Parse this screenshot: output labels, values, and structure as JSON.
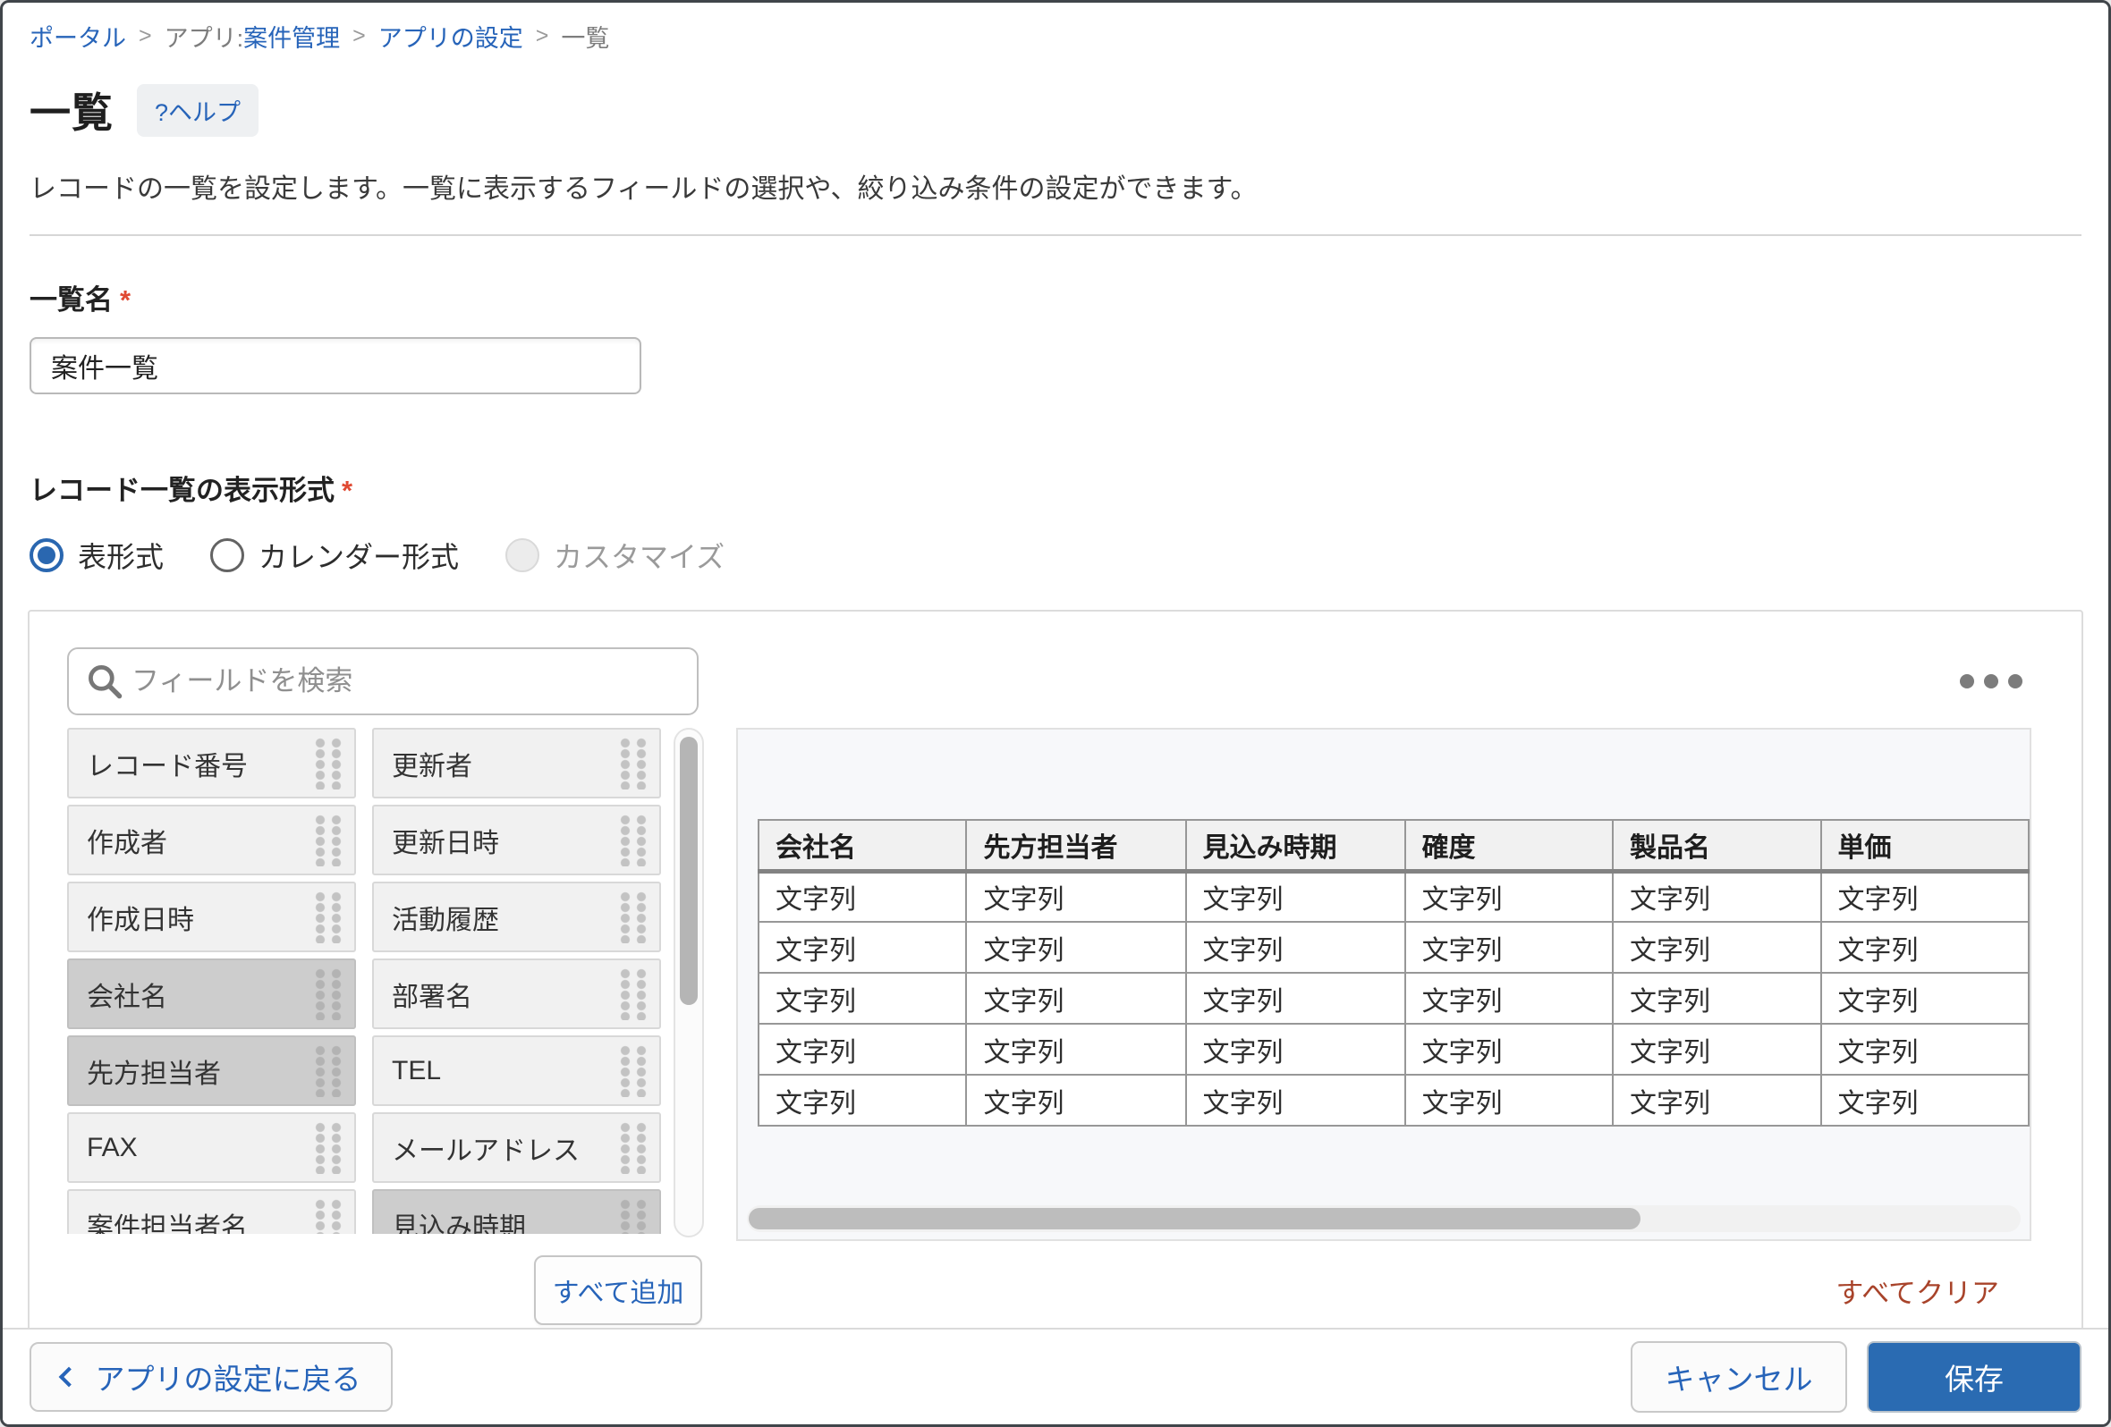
{
  "breadcrumb": {
    "separator": ">",
    "items": [
      {
        "label": "ポータル",
        "type": "link"
      },
      {
        "label": "アプリ:",
        "type": "text",
        "joined_with_next": true
      },
      {
        "label": "案件管理",
        "type": "link"
      },
      {
        "label": "アプリの設定",
        "type": "link"
      },
      {
        "label": "一覧",
        "type": "current"
      }
    ]
  },
  "page": {
    "title": "一覧",
    "help_label": "?ヘルプ",
    "description": "レコードの一覧を設定します。一覧に表示するフィールドの選択や、絞り込み条件の設定ができます。"
  },
  "form": {
    "required_mark": "*",
    "list_name": {
      "label": "一覧名",
      "value": "案件一覧"
    },
    "display_format": {
      "label": "レコード一覧の表示形式",
      "options": [
        {
          "label": "表形式",
          "state": "selected"
        },
        {
          "label": "カレンダー形式",
          "state": "unselected"
        },
        {
          "label": "カスタマイズ",
          "state": "disabled"
        }
      ]
    }
  },
  "field_picker": {
    "search_placeholder": "フィールドを検索",
    "more_menu_icon": "ellipsis-icon",
    "fields": [
      {
        "label": "レコード番号",
        "used": false
      },
      {
        "label": "更新者",
        "used": false
      },
      {
        "label": "作成者",
        "used": false
      },
      {
        "label": "更新日時",
        "used": false
      },
      {
        "label": "作成日時",
        "used": false
      },
      {
        "label": "活動履歴",
        "used": false
      },
      {
        "label": "会社名",
        "used": true
      },
      {
        "label": "部署名",
        "used": false
      },
      {
        "label": "先方担当者",
        "used": true
      },
      {
        "label": "TEL",
        "used": false
      },
      {
        "label": "FAX",
        "used": false
      },
      {
        "label": "メールアドレス",
        "used": false
      },
      {
        "label": "案件担当者名",
        "used": false
      },
      {
        "label": "見込み時期",
        "used": true
      }
    ],
    "add_all_label": "すべて追加",
    "clear_all_label": "すべてクリア"
  },
  "preview": {
    "columns": [
      "会社名",
      "先方担当者",
      "見込み時期",
      "確度",
      "製品名",
      "単価"
    ],
    "cell_text": "文字列",
    "row_count": 5
  },
  "footer": {
    "back_label": "アプリの設定に戻る",
    "cancel_label": "キャンセル",
    "save_label": "保存"
  },
  "colors": {
    "link_blue": "#2764b9",
    "primary_blue": "#2a6bb2",
    "radio_blue": "#2a67b0",
    "required_red": "#e04a33",
    "clear_red": "#a8432a",
    "chip_used_gray": "#cdcdcd",
    "panel_border": "#dcdcdc"
  }
}
